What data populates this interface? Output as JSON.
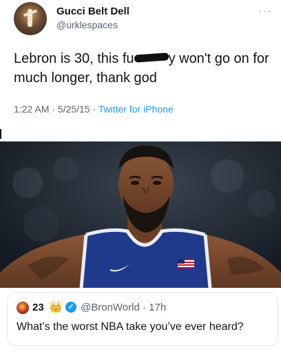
{
  "tweet": {
    "name": "Gucci Belt Dell",
    "handle": "@urklespaces",
    "text_before": "Lebron is 30, this fu",
    "text_after": "y won't go on for much longer, thank god",
    "time": "1:22 AM",
    "date": "5/25/15",
    "source": "Twitter for iPhone",
    "more_label": "···"
  },
  "reply": {
    "name": "23",
    "crown": "👑",
    "handle": "@BronWorld",
    "time": "17h",
    "text": "What’s the worst NBA take you’ve ever heard?",
    "verified_mark": "✓"
  },
  "photo": {
    "jersey_color": "#1f3a8a",
    "skin_color": "#7a4b30"
  }
}
